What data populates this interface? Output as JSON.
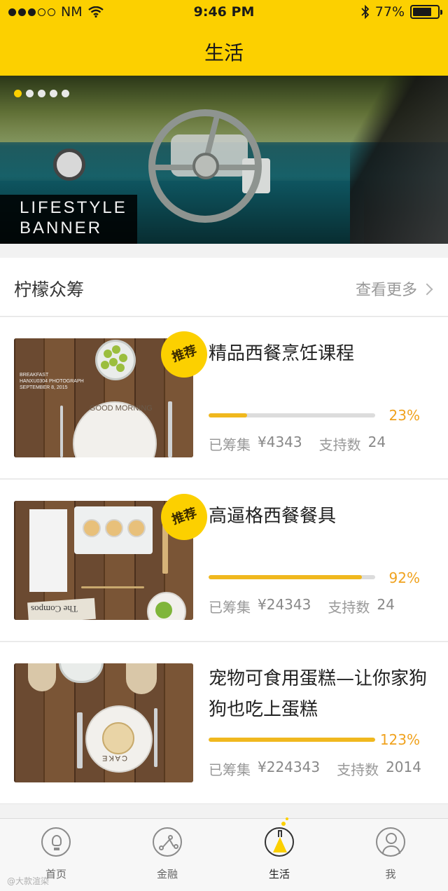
{
  "status": {
    "carrier": "NM",
    "time": "9:46 PM",
    "battery": "77%",
    "battery_level": 0.77
  },
  "header": {
    "title": "生活"
  },
  "banner": {
    "line1": "LIFESTYLE",
    "line2": "BANNER",
    "page_count": 5,
    "active_page": 1
  },
  "section": {
    "title": "柠檬众筹",
    "more_label": "查看更多"
  },
  "cards": [
    {
      "badge": "推荐",
      "title": "精品西餐烹饪课程",
      "progress": 0.23,
      "percent": "23%",
      "raised_label": "已筹集",
      "raised": "¥4343",
      "backers_label": "支持数",
      "backers": "24",
      "thumb_text": [
        "BREAKFAST",
        "HANXU0304 PHOTOGRAPH",
        "SEPTEMBER 8, 2015",
        "GOOD MORNING"
      ]
    },
    {
      "badge": "推荐",
      "title": "高逼格西餐餐具",
      "progress": 0.92,
      "percent": "92%",
      "raised_label": "已筹集",
      "raised": "¥24343",
      "backers_label": "支持数",
      "backers": "24",
      "thumb_text": [
        "The Compos"
      ]
    },
    {
      "badge": "",
      "title": "宠物可食用蛋糕—让你家狗狗也吃上蛋糕",
      "progress": 1.0,
      "percent": "123%",
      "raised_label": "已筹集",
      "raised": "¥224343",
      "backers_label": "支持数",
      "backers": "2014",
      "thumb_text": [
        "CAKE"
      ]
    }
  ],
  "tabs": [
    {
      "label": "首页",
      "icon": "bulb-icon",
      "active": false
    },
    {
      "label": "金融",
      "icon": "network-icon",
      "active": false
    },
    {
      "label": "生活",
      "icon": "flask-icon",
      "active": true
    },
    {
      "label": "我",
      "icon": "user-icon",
      "active": false
    }
  ],
  "watermark": "@大款渲染",
  "colors": {
    "brand_yellow": "#fcd000",
    "progress_orange": "#f0b81e",
    "percent_text": "#f0a21e"
  }
}
